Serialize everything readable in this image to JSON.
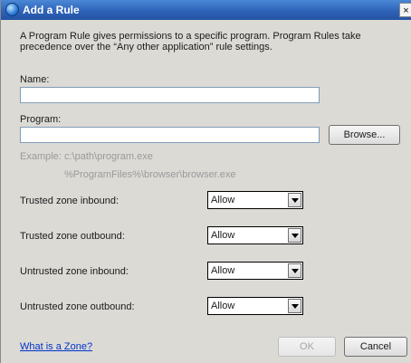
{
  "window": {
    "title": "Add a Rule",
    "close_glyph": "×"
  },
  "description": "A Program Rule gives permissions to a specific program. Program Rules take precedence over the “Any other application” rule settings.",
  "name_field": {
    "label": "Name:",
    "value": ""
  },
  "program_field": {
    "label": "Program:",
    "value": ""
  },
  "browse_button": "Browse...",
  "example": {
    "label": "Example:",
    "line1": "c:\\path\\program.exe",
    "line2": "%ProgramFiles%\\browser\\browser.exe"
  },
  "zones": [
    {
      "label": "Trusted zone inbound:",
      "value": "Allow"
    },
    {
      "label": "Trusted zone outbound:",
      "value": "Allow"
    },
    {
      "label": "Untrusted zone inbound:",
      "value": "Allow"
    },
    {
      "label": "Untrusted zone outbound:",
      "value": "Allow"
    }
  ],
  "zone_link": "What is a Zone?",
  "ok_button": "OK",
  "cancel_button": "Cancel"
}
